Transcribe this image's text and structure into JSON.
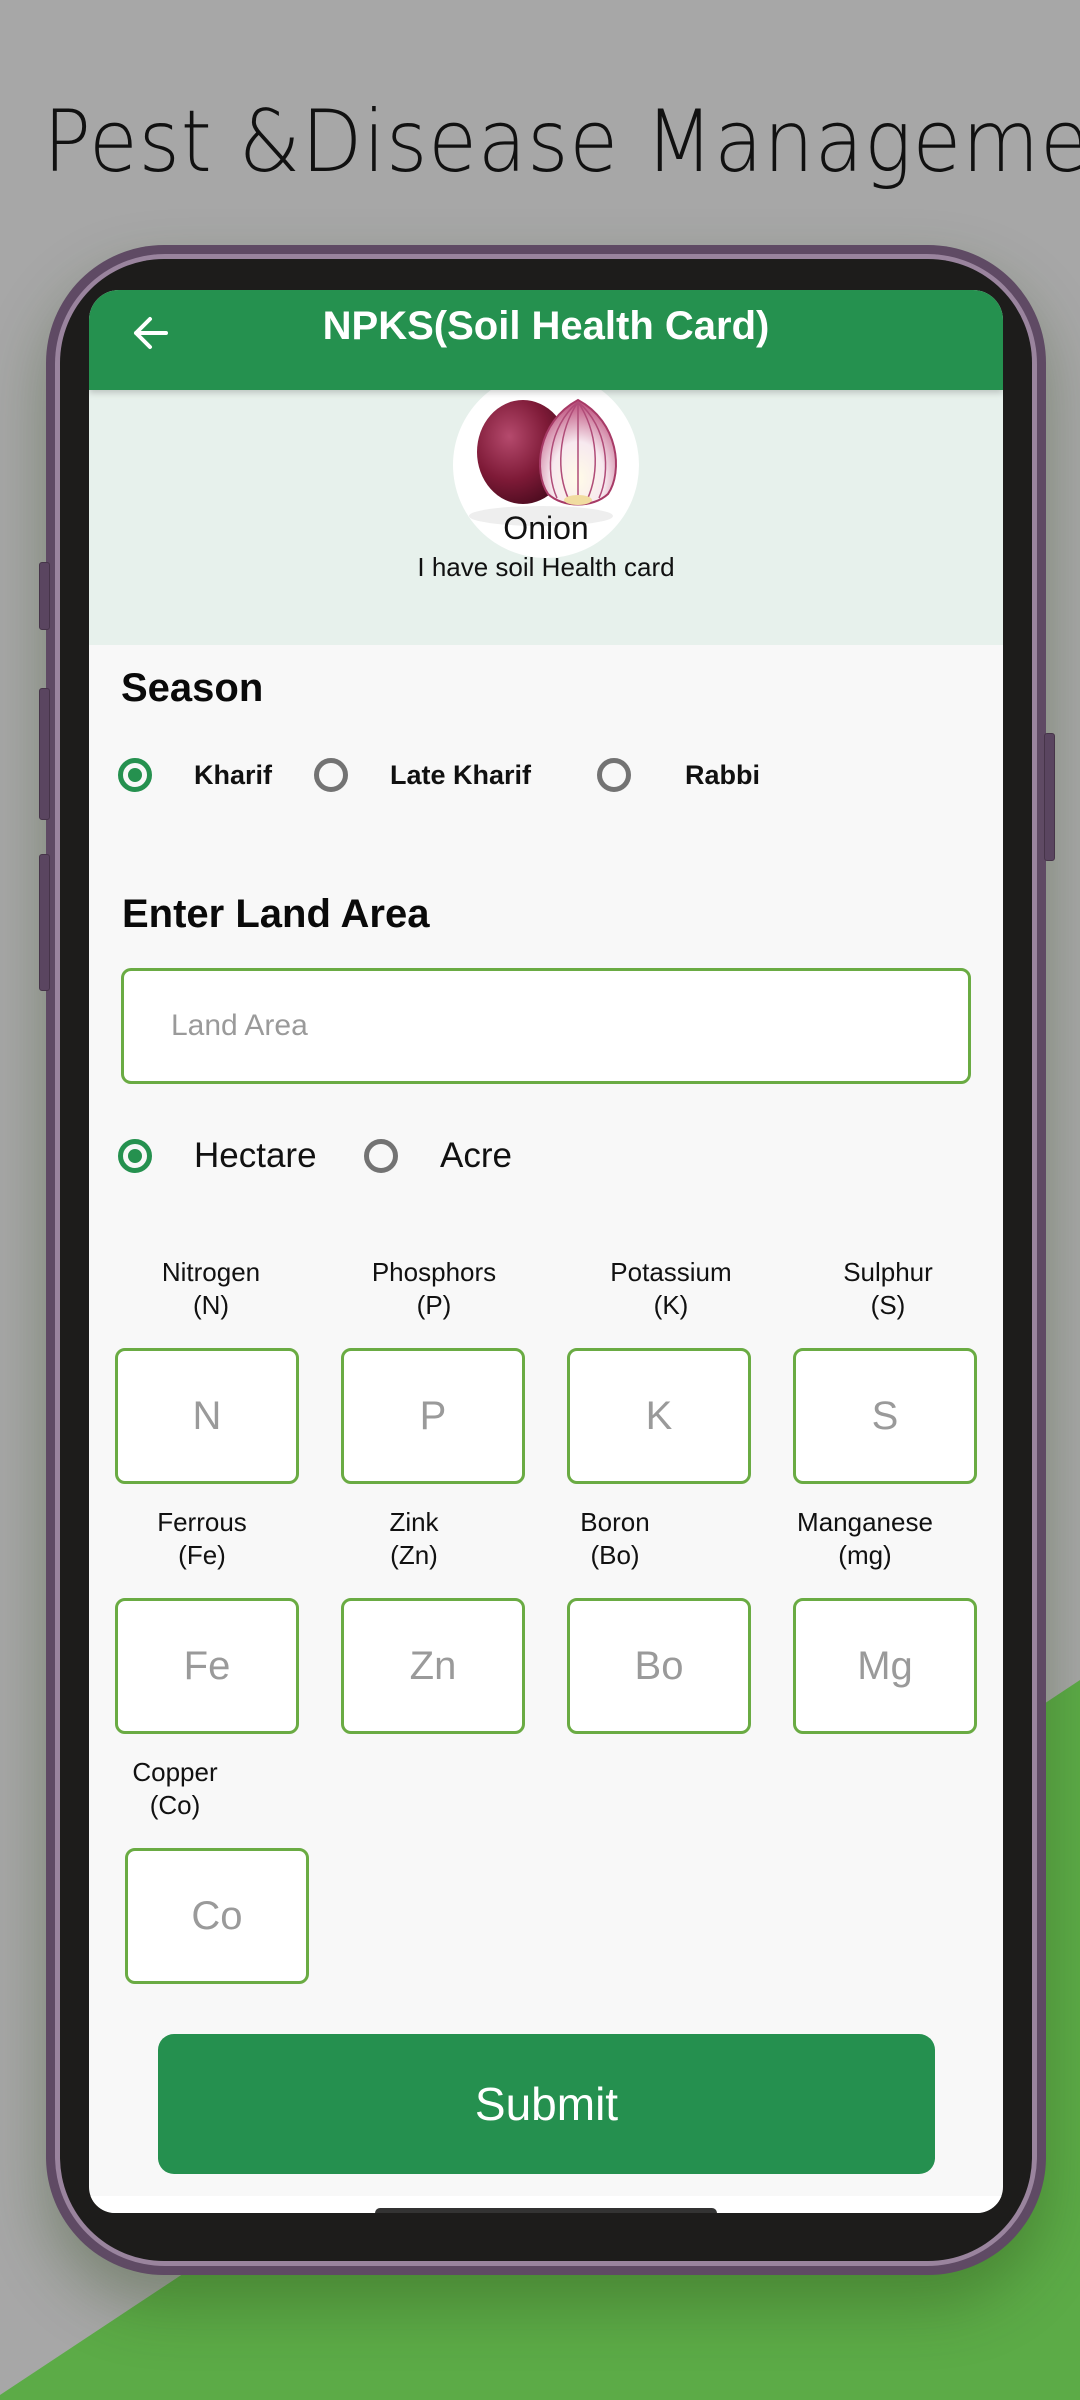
{
  "promo": {
    "title": "Pest &Disease Management"
  },
  "colors": {
    "brand_green": "#25914f",
    "field_border": "#6aab43",
    "hero_bg": "#e7f1ec",
    "page_bg": "#a7a7a7",
    "accent_green": "#5cab47",
    "phone_frame": "#5f4a64"
  },
  "app_bar": {
    "back_icon": "arrow-left-icon",
    "title": "NPKS(Soil Health Card)"
  },
  "crop": {
    "image": "onion-image",
    "name": "Onion",
    "subtitle": "I have soil Health card"
  },
  "season": {
    "title": "Season",
    "options": [
      {
        "label": "Kharif",
        "selected": true
      },
      {
        "label": "Late Kharif",
        "selected": false
      },
      {
        "label": "Rabbi",
        "selected": false
      }
    ]
  },
  "land_area": {
    "title": "Enter Land Area",
    "value": "",
    "placeholder": "Land Area",
    "units": [
      {
        "label": "Hectare",
        "selected": true
      },
      {
        "label": "Acre",
        "selected": false
      }
    ]
  },
  "nutrients": [
    {
      "name": "Nitrogen",
      "symbol_label": "(N)",
      "placeholder": "N",
      "value": ""
    },
    {
      "name": "Phosphors",
      "symbol_label": "(P)",
      "placeholder": "P",
      "value": ""
    },
    {
      "name": "Potassium",
      "symbol_label": "(K)",
      "placeholder": "K",
      "value": ""
    },
    {
      "name": "Sulphur",
      "symbol_label": "(S)",
      "placeholder": "S",
      "value": ""
    },
    {
      "name": "Ferrous",
      "symbol_label": "(Fe)",
      "placeholder": "Fe",
      "value": ""
    },
    {
      "name": "Zink",
      "symbol_label": "(Zn)",
      "placeholder": "Zn",
      "value": ""
    },
    {
      "name": "Boron",
      "symbol_label": "(Bo)",
      "placeholder": "Bo",
      "value": ""
    },
    {
      "name": "Manganese",
      "symbol_label": "(mg)",
      "placeholder": "Mg",
      "value": ""
    },
    {
      "name": "Copper",
      "symbol_label": "(Co)",
      "placeholder": "Co",
      "value": ""
    }
  ],
  "submit": {
    "label": "Submit"
  }
}
